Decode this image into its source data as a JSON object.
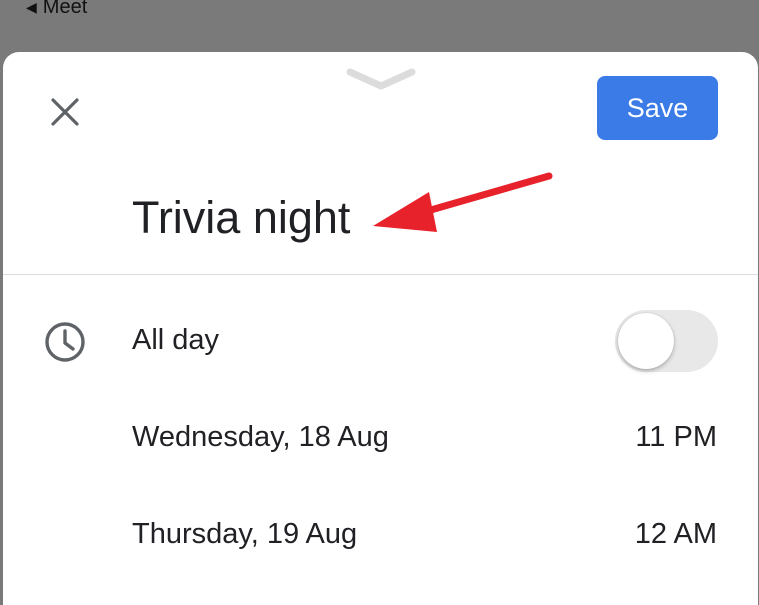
{
  "status_bar": {
    "back_label": "Meet"
  },
  "header": {
    "save_label": "Save",
    "accent_color": "#3a7be8"
  },
  "event": {
    "title": "Trivia night"
  },
  "all_day": {
    "label": "All day",
    "enabled": false
  },
  "start": {
    "date": "Wednesday, 18 Aug",
    "time": "11 PM"
  },
  "end": {
    "date": "Thursday, 19 Aug",
    "time": "12 AM"
  },
  "annotation": {
    "arrow_color": "#e8222b"
  }
}
